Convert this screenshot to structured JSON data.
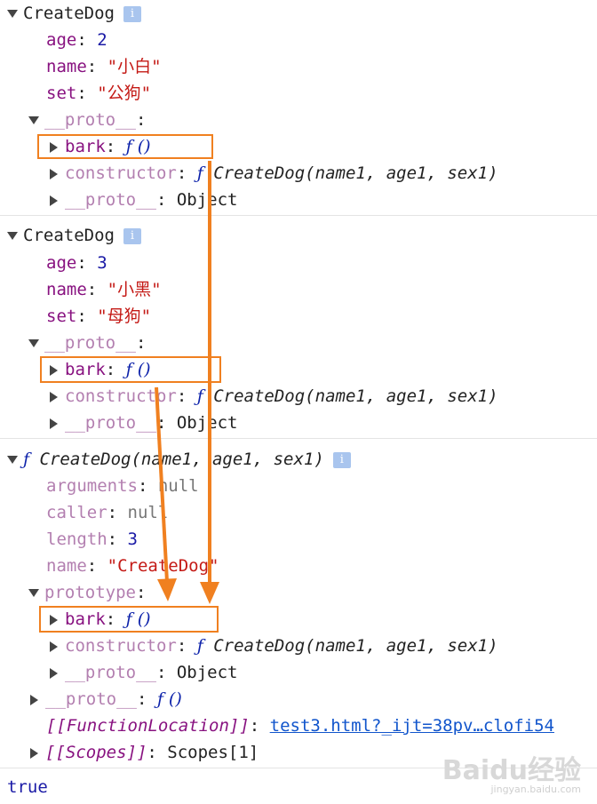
{
  "block1": {
    "title": "CreateDog",
    "props": [
      {
        "key": "age",
        "value": "2",
        "type": "num"
      },
      {
        "key": "name",
        "value": "\"小白\"",
        "type": "str"
      },
      {
        "key": "set",
        "value": "\"公狗\"",
        "type": "str"
      }
    ],
    "proto_label": "__proto__",
    "bark_key": "bark",
    "bark_value": "ƒ ()",
    "constructor_key": "constructor",
    "constructor_f": "ƒ",
    "constructor_value": "CreateDog(name1, age1, sex1)",
    "inner_proto_key": "__proto__",
    "inner_proto_value": "Object"
  },
  "block2": {
    "title": "CreateDog",
    "props": [
      {
        "key": "age",
        "value": "3",
        "type": "num"
      },
      {
        "key": "name",
        "value": "\"小黑\"",
        "type": "str"
      },
      {
        "key": "set",
        "value": "\"母狗\"",
        "type": "str"
      }
    ],
    "proto_label": "__proto__",
    "bark_key": "bark",
    "bark_value": "ƒ ()",
    "constructor_key": "constructor",
    "constructor_f": "ƒ",
    "constructor_value": "CreateDog(name1, age1, sex1)",
    "inner_proto_key": "__proto__",
    "inner_proto_value": "Object"
  },
  "block3": {
    "f": "ƒ",
    "title": "CreateDog(name1, age1, sex1)",
    "arguments_key": "arguments",
    "arguments_value": "null",
    "caller_key": "caller",
    "caller_value": "null",
    "length_key": "length",
    "length_value": "3",
    "name_key": "name",
    "name_value": "\"CreateDog\"",
    "prototype_key": "prototype",
    "bark_key": "bark",
    "bark_value": "ƒ ()",
    "constructor_key": "constructor",
    "constructor_f": "ƒ",
    "constructor_value": "CreateDog(name1, age1, sex1)",
    "inner_proto_key": "__proto__",
    "inner_proto_value": "Object",
    "proto_key": "__proto__",
    "proto_value": "ƒ ()",
    "function_location_key": "[[FunctionLocation]]",
    "function_location_value": "test3.html?_ijt=38pv…clofi54",
    "scopes_key": "[[Scopes]]",
    "scopes_value": "Scopes[1]"
  },
  "result": "true",
  "info_icon": "i",
  "watermark": {
    "main": "Baidu经验",
    "sub": "jingyan.baidu.com"
  },
  "colors": {
    "annotation": "#f08020",
    "key": "#881280",
    "string": "#c41a16",
    "number": "#1a1aa6"
  }
}
